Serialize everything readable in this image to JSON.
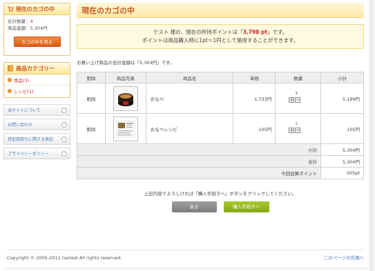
{
  "sidebar": {
    "cart_title": "現在のカゴの中",
    "total_qty_label": "合計数量：",
    "total_qty_value": "4",
    "total_amount_label": "商品金額：5,304円",
    "view_cart_label": "カゴの中を見る",
    "category_title": "商品カテゴリー",
    "categories": [
      {
        "label": "食品(3)"
      },
      {
        "label": "レシピ(1)"
      }
    ],
    "nav": [
      {
        "label": "当サイトについて"
      },
      {
        "label": "お問い合わせ"
      },
      {
        "label": "特定商取引に関する表記"
      },
      {
        "label": "プライバシーポリシー"
      }
    ]
  },
  "main": {
    "title": "現在のカゴの中",
    "notice_line1_prefix": "テスト 様の、現在の所持ポイントは「",
    "notice_points": "3,798 pt",
    "notice_line1_suffix": "」です。",
    "notice_line2": "ポイントは商品購入時に1pt＝1円として使用することができます。",
    "total_line": "お買い上げ商品の合計金額は「5,304円」です。",
    "columns": [
      "削除",
      "商品写真",
      "商品名",
      "単価",
      "数量",
      "小計"
    ],
    "items": [
      {
        "delete": "削除",
        "name": "おなべ",
        "price": "1,733円",
        "qty": "3",
        "subtotal": "5,199円"
      },
      {
        "delete": "削除",
        "name": "おなべレシピ",
        "price": "105円",
        "qty": "1",
        "subtotal": "105円"
      }
    ],
    "summary": [
      {
        "label": "小計",
        "value": "5,304円"
      },
      {
        "label": "合計",
        "value": "5,304円"
      },
      {
        "label": "今回加算ポイント",
        "value": "505pt"
      }
    ],
    "confirm_text": "上記内容でよろしければ「購入手続きへ」ボタンをクリックしてください。",
    "back_label": "戻る",
    "proceed_label": "購入手続きへ"
  },
  "footer": {
    "copyright": "Copyright © 2005-2012 taxtest All rights reserved.",
    "to_top": "このページの先頭へ"
  },
  "colors": {
    "accent": "#c8581c",
    "link": "#4a77b8",
    "alert": "#d6281c",
    "proceed": "#8fb01a"
  }
}
